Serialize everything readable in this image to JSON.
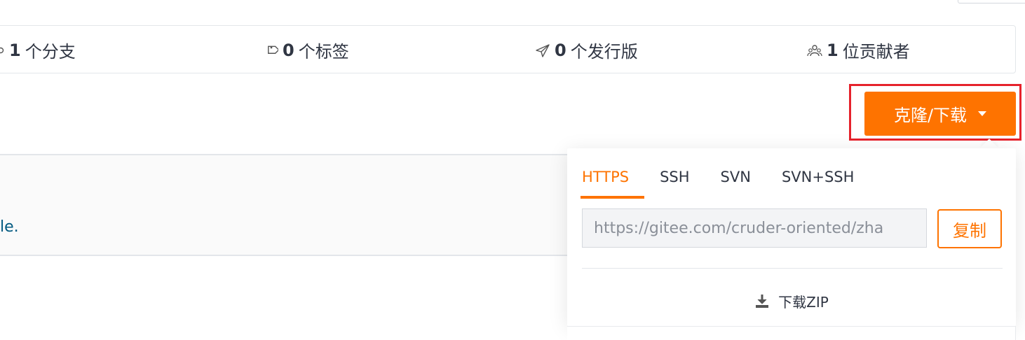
{
  "stats": {
    "branches": {
      "count": "1",
      "label": "个分支",
      "icon": "branch-icon"
    },
    "tags": {
      "count": "0",
      "label": "个标签",
      "icon": "tag-icon"
    },
    "releases": {
      "count": "0",
      "label": "个发行版",
      "icon": "paper-plane-icon"
    },
    "contributors": {
      "count": "1",
      "label": "位贡献者",
      "icon": "people-icon"
    }
  },
  "clone_button": {
    "label": "克隆/下载",
    "icon": "caret-down-icon"
  },
  "readme": {
    "partial_text": "le."
  },
  "dropdown": {
    "tabs": [
      {
        "label": "HTTPS",
        "active": true
      },
      {
        "label": "SSH",
        "active": false
      },
      {
        "label": "SVN",
        "active": false
      },
      {
        "label": "SVN+SSH",
        "active": false
      }
    ],
    "url_value": "https://gitee.com/cruder-oriented/zha",
    "copy_label": "复制",
    "download_zip_label": "下载ZIP",
    "download_icon": "download-icon"
  },
  "colors": {
    "accent": "#fe7300",
    "highlight_border": "#e6222c",
    "text": "#303643",
    "link": "#005980"
  }
}
